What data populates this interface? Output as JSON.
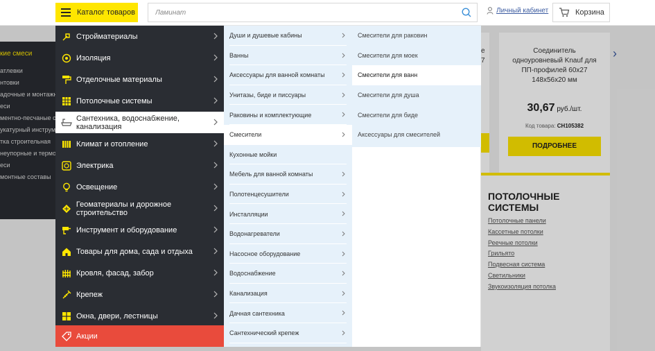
{
  "header": {
    "catalog_label": "Каталог товаров",
    "search_placeholder": "Ламинат",
    "account_label": "Личный кабинет",
    "cart_label": "Корзина"
  },
  "background": {
    "left_heading": "кие смеси",
    "left_items": [
      "атлевки",
      "нтовки",
      "адочные и монтажн",
      "еси",
      "ментно-песчаные см",
      "укатурный инструм",
      "тка строительная",
      "неупорные и термос",
      "еси",
      "монтные составы"
    ],
    "product": {
      "name_lines": [
        "Соединитель",
        "одноуровневый Knauf для",
        "ПП-профилей 60х27",
        "148х56х20 мм"
      ],
      "prev_name_fragment": [
        "е",
        "7"
      ],
      "price": "30,67",
      "price_unit": " руб./шт.",
      "code_label": "Код товара:",
      "code": "CH105382",
      "more_label": "ПОДРОБНЕЕ"
    },
    "ceiling": {
      "title": "ПОТОЛОЧНЫЕ СИСТЕМЫ",
      "links": [
        "Потолочные панели",
        "Кассетные потолки",
        "Реечные потолки",
        "Грильято",
        "Подвесная система",
        "Светильники",
        "Звукоизоляция потолка"
      ]
    }
  },
  "menu1": {
    "items": [
      {
        "label": "Стройматериалы",
        "icon": "trowel-icon"
      },
      {
        "label": "Изоляция",
        "icon": "insulation-roll-icon"
      },
      {
        "label": "Отделочные материалы",
        "icon": "paint-roller-icon"
      },
      {
        "label": "Потолочные системы",
        "icon": "ceiling-grid-icon"
      },
      {
        "label": "Сантехника, водоснабжение, канализация",
        "icon": "bathtub-icon"
      },
      {
        "label": "Климат и отопление",
        "icon": "radiator-icon"
      },
      {
        "label": "Электрика",
        "icon": "socket-icon"
      },
      {
        "label": "Освещение",
        "icon": "lightbulb-icon"
      },
      {
        "label": "Геоматериалы и дорожное строительство",
        "icon": "geo-grid-icon"
      },
      {
        "label": "Инструмент и оборудование",
        "icon": "drill-icon"
      },
      {
        "label": "Товары для дома, сада и отдыха",
        "icon": "house-icon"
      },
      {
        "label": "Кровля, фасад, забор",
        "icon": "fence-icon"
      },
      {
        "label": "Крепеж",
        "icon": "screw-icon"
      },
      {
        "label": "Окна, двери, лестницы",
        "icon": "window-icon"
      },
      {
        "label": "Акции",
        "icon": "tag-icon"
      }
    ]
  },
  "menu2": {
    "items": [
      "Души и душевые кабины",
      "Ванны",
      "Аксессуары для ванной комнаты",
      "Унитазы, биде и писсуары",
      "Раковины и комплектующие",
      "Смесители",
      "Кухонные мойки",
      "Мебель для ванной комнаты",
      "Полотенцесушители",
      "Инсталляции",
      "Водонагреватели",
      "Насосное оборудование",
      "Водоснабжение",
      "Канализация",
      "Дачная сантехника",
      "Сантехнический крепеж"
    ]
  },
  "menu3": {
    "items": [
      "Смесители для раковин",
      "Смесители для моек",
      "Смесители для ванн",
      "Смесители для душа",
      "Смесители для биде",
      "Аксессуары для смесителей"
    ]
  },
  "colors": {
    "accent": "#ffe600",
    "menu_dark": "#2a2d33",
    "promo": "#e94b3c",
    "submenu_bg": "#e6f1fa"
  }
}
